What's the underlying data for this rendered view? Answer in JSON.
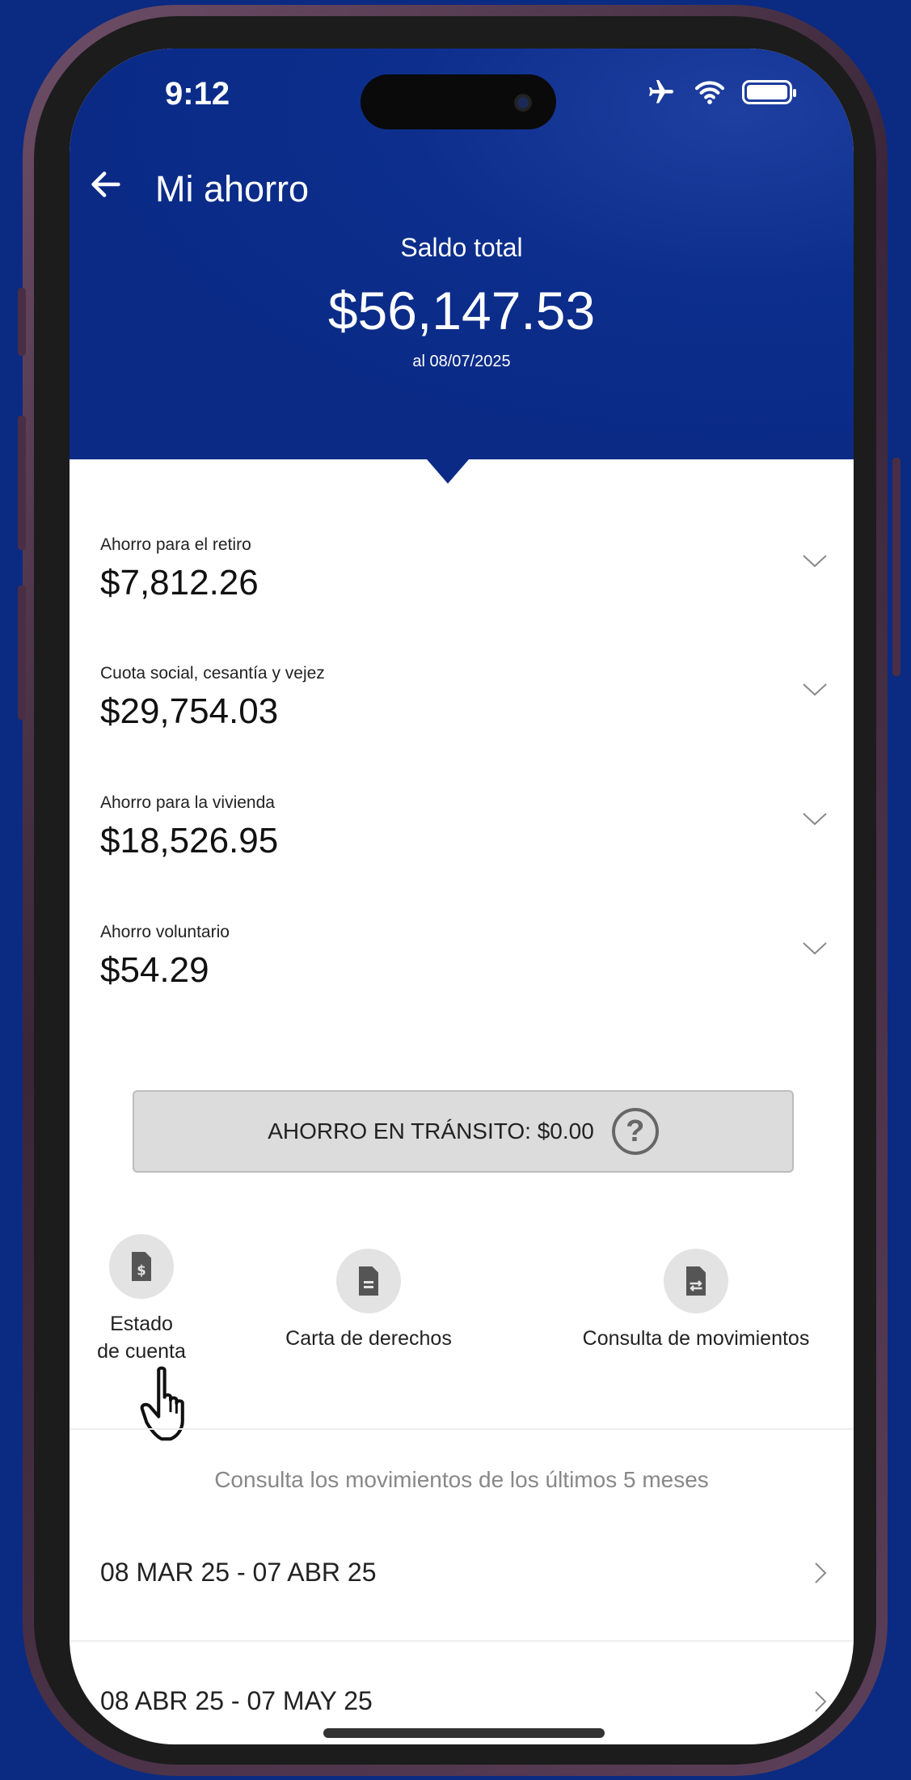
{
  "status_bar": {
    "time": "9:12"
  },
  "header": {
    "title": "Mi ahorro",
    "saldo_label": "Saldo total",
    "saldo_amount": "$56,147.53",
    "saldo_date": "al 08/07/2025"
  },
  "balances": [
    {
      "label": "Ahorro para el retiro",
      "amount": "$7,812.26"
    },
    {
      "label": "Cuota social, cesantía y vejez",
      "amount": "$29,754.03"
    },
    {
      "label": "Ahorro para la vivienda",
      "amount": "$18,526.95"
    },
    {
      "label": "Ahorro voluntario",
      "amount": "$54.29"
    }
  ],
  "transit": {
    "text": "AHORRO EN TRÁNSITO: $0.00",
    "help_glyph": "?"
  },
  "actions": [
    {
      "label_line1": "Estado",
      "label_line2": "de cuenta",
      "icon": "dollar-document-icon"
    },
    {
      "label": "Carta de derechos",
      "icon": "document-icon"
    },
    {
      "label": "Consulta de movimientos",
      "icon": "transfer-document-icon"
    }
  ],
  "movements": {
    "caption": "Consulta los movimientos de los últimos 5 meses",
    "periods": [
      "08 MAR 25 - 07 ABR 25",
      "08 ABR 25 - 07 MAY 25"
    ]
  },
  "colors": {
    "header_bg": "#0a2a86",
    "page_bg": "#0b2a82",
    "transit_bg": "#dcdcdc"
  }
}
